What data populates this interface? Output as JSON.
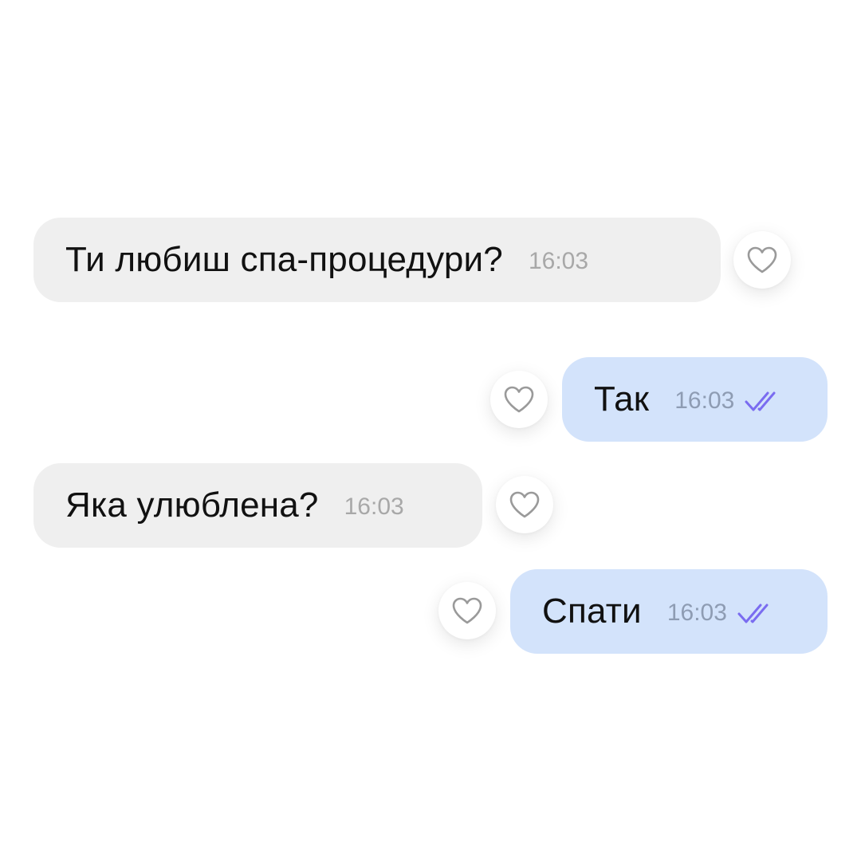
{
  "messages": [
    {
      "direction": "incoming",
      "text": "Ти любиш спа-процедури?",
      "time": "16:03"
    },
    {
      "direction": "outgoing",
      "text": "Так",
      "time": "16:03",
      "status_icon": "double-check-icon"
    },
    {
      "direction": "incoming",
      "text": "Яка улюблена?",
      "time": "16:03"
    },
    {
      "direction": "outgoing",
      "text": "Спати",
      "time": "16:03",
      "status_icon": "double-check-icon"
    }
  ],
  "reaction_icon": "heart-outline-icon",
  "colors": {
    "incoming_bubble": "#efefef",
    "outgoing_bubble": "#d3e3fb",
    "read_check": "#7a6cf0",
    "heart_stroke": "#9a9a9a"
  }
}
